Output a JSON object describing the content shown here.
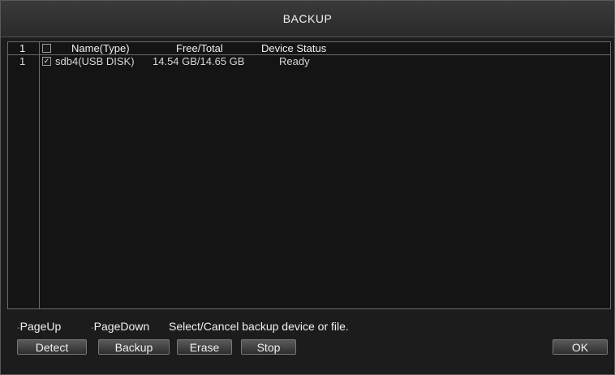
{
  "window": {
    "title": "BACKUP"
  },
  "table": {
    "header": {
      "index": "1",
      "name": "Name(Type)",
      "free_total": "Free/Total",
      "status": "Device Status"
    },
    "rows": [
      {
        "index": "1",
        "checked": true,
        "check_mark": "✓",
        "name": "sdb4(USB DISK)",
        "free_total": "14.54 GB/14.65 GB",
        "status": "Ready"
      }
    ]
  },
  "footer": {
    "page_up": "PageUp",
    "page_down": "PageDown",
    "hint": "Select/Cancel backup device or file."
  },
  "buttons": {
    "detect": "Detect",
    "backup": "Backup",
    "erase": "Erase",
    "stop": "Stop",
    "ok": "OK"
  }
}
